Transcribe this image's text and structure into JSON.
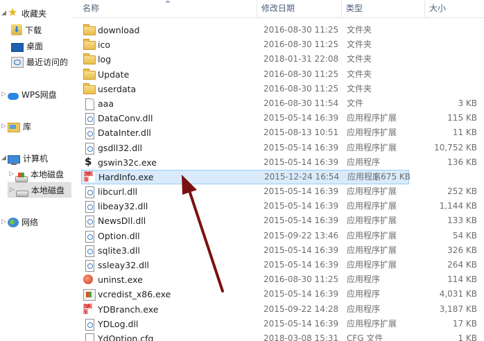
{
  "nav": {
    "favorites": "收藏夹",
    "downloads": "下载",
    "desktop": "桌面",
    "recent": "最近访问的",
    "wps": "WPS网盘",
    "library": "库",
    "computer": "计算机",
    "disk1": "本地磁盘",
    "disk2": "本地磁盘",
    "network": "网络"
  },
  "columns": {
    "name": "名称",
    "date": "修改日期",
    "type": "类型",
    "size": "大小"
  },
  "files": [
    {
      "name": "download",
      "date": "2016-08-30 11:25",
      "type": "文件夹",
      "size": "",
      "icon": "folder-icon"
    },
    {
      "name": "ico",
      "date": "2016-08-30 11:25",
      "type": "文件夹",
      "size": "",
      "icon": "folder-icon"
    },
    {
      "name": "log",
      "date": "2018-01-31 22:08",
      "type": "文件夹",
      "size": "",
      "icon": "folder-icon"
    },
    {
      "name": "Update",
      "date": "2016-08-30 11:25",
      "type": "文件夹",
      "size": "",
      "icon": "folder-icon"
    },
    {
      "name": "userdata",
      "date": "2016-08-30 11:25",
      "type": "文件夹",
      "size": "",
      "icon": "folder-icon"
    },
    {
      "name": "aaa",
      "date": "2016-08-30 11:54",
      "type": "文件",
      "size": "3 KB",
      "icon": "file-icon"
    },
    {
      "name": "DataConv.dll",
      "date": "2015-05-14 16:39",
      "type": "应用程序扩展",
      "size": "115 KB",
      "icon": "dll-icon"
    },
    {
      "name": "DataInter.dll",
      "date": "2015-08-13 10:51",
      "type": "应用程序扩展",
      "size": "11 KB",
      "icon": "dll-icon"
    },
    {
      "name": "gsdll32.dll",
      "date": "2015-05-14 16:39",
      "type": "应用程序扩展",
      "size": "10,752 KB",
      "icon": "dll-icon"
    },
    {
      "name": "gswin32c.exe",
      "date": "2015-05-14 16:39",
      "type": "应用程序",
      "size": "136 KB",
      "icon": "ghostscript-icon"
    },
    {
      "name": "HardInfo.exe",
      "date": "2015-12-24 16:54",
      "type": "应用程序",
      "size": "1,675 KB",
      "icon": "app-logo-icon"
    },
    {
      "name": "libcurl.dll",
      "date": "2015-05-14 16:39",
      "type": "应用程序扩展",
      "size": "252 KB",
      "icon": "dll-icon"
    },
    {
      "name": "libeay32.dll",
      "date": "2015-05-14 16:39",
      "type": "应用程序扩展",
      "size": "1,144 KB",
      "icon": "dll-icon"
    },
    {
      "name": "NewsDll.dll",
      "date": "2015-05-14 16:39",
      "type": "应用程序扩展",
      "size": "133 KB",
      "icon": "dll-icon"
    },
    {
      "name": "Option.dll",
      "date": "2015-09-22 13:46",
      "type": "应用程序扩展",
      "size": "54 KB",
      "icon": "dll-icon"
    },
    {
      "name": "sqlite3.dll",
      "date": "2015-05-14 16:39",
      "type": "应用程序扩展",
      "size": "326 KB",
      "icon": "dll-icon"
    },
    {
      "name": "ssleay32.dll",
      "date": "2015-05-14 16:39",
      "type": "应用程序扩展",
      "size": "264 KB",
      "icon": "dll-icon"
    },
    {
      "name": "uninst.exe",
      "date": "2016-08-30 11:25",
      "type": "应用程序",
      "size": "114 KB",
      "icon": "uninstall-icon"
    },
    {
      "name": "vcredist_x86.exe",
      "date": "2015-05-14 16:39",
      "type": "应用程序",
      "size": "4,031 KB",
      "icon": "installer-icon"
    },
    {
      "name": "YDBranch.exe",
      "date": "2015-09-22 14:28",
      "type": "应用程序",
      "size": "3,187 KB",
      "icon": "app-logo-icon"
    },
    {
      "name": "YDLog.dll",
      "date": "2015-05-14 16:39",
      "type": "应用程序扩展",
      "size": "17 KB",
      "icon": "dll-icon"
    },
    {
      "name": "YdOption.cfg",
      "date": "2018-03-08 15:31",
      "type": "CFG 文件",
      "size": "1 KB",
      "icon": "cfg-file-icon"
    }
  ],
  "selected_file": "HardInfo.exe",
  "colors": {
    "selection_bg": "#d9ebfb",
    "selection_border": "#99cef6",
    "arrow": "#7a1010"
  }
}
